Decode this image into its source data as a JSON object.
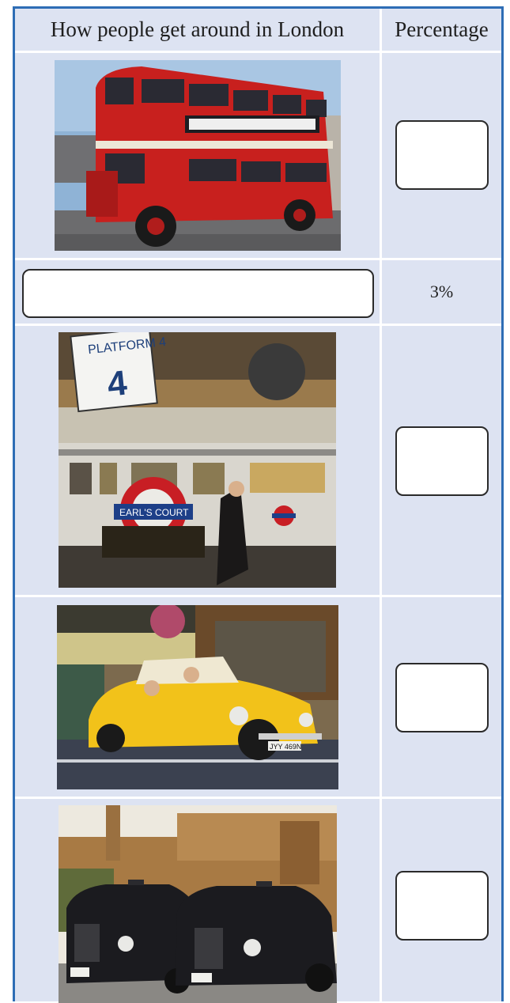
{
  "table": {
    "headers": {
      "transport": "How people get around in London",
      "percentage": "Percentage"
    },
    "rows": [
      {
        "image": "red-double-decker-bus",
        "percentage": ""
      },
      {
        "label": "",
        "percentage": "3%"
      },
      {
        "image": "underground-train-platform",
        "percentage": ""
      },
      {
        "image": "yellow-beetle-car",
        "percentage": ""
      },
      {
        "image": "black-taxi-cabs",
        "percentage": ""
      }
    ]
  },
  "signage": {
    "platform_sign": "PLATFORM 4",
    "station_name": "EARL'S COURT",
    "car_plate": "JYY 469N"
  },
  "colors": {
    "border": "#2e6db5",
    "cell_background": "#dde3f2",
    "bus_red": "#c8201e",
    "beetle_yellow": "#f2c21a",
    "taxi_black": "#1b1b1f"
  }
}
